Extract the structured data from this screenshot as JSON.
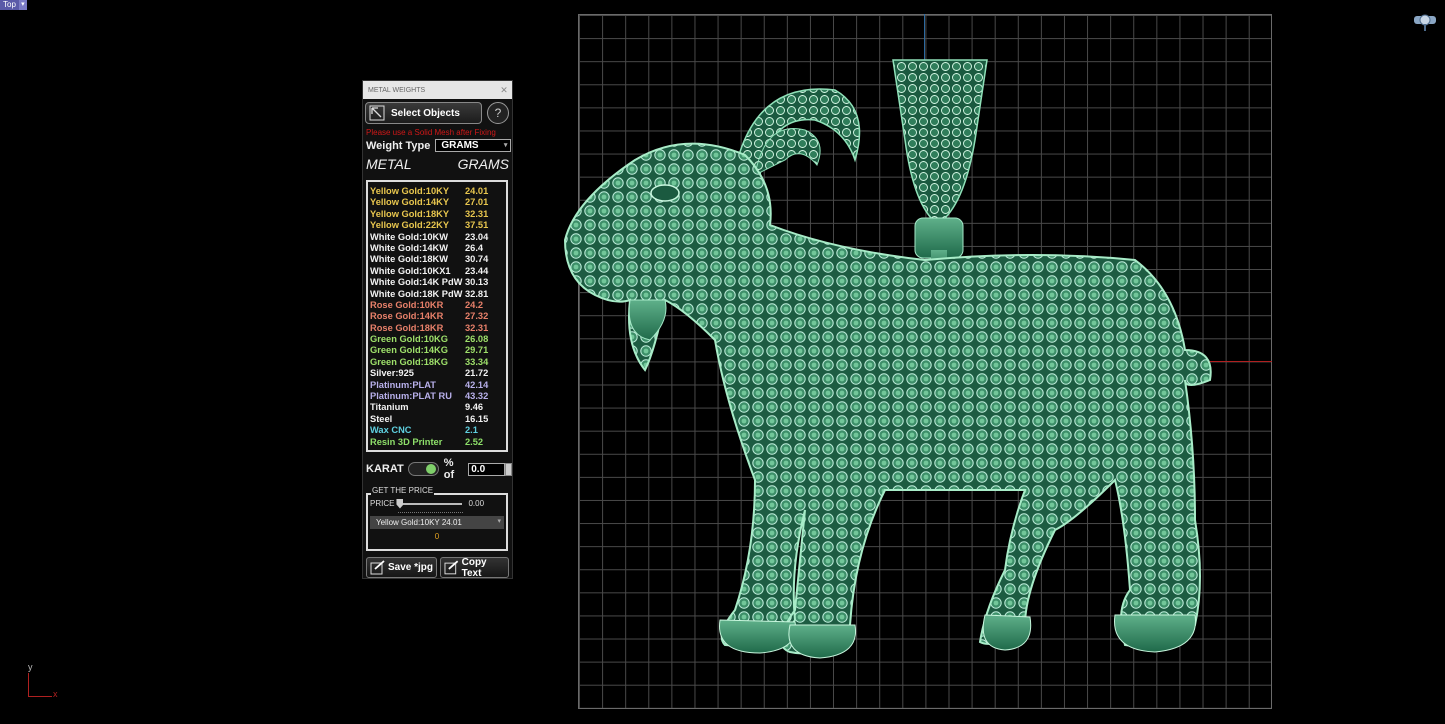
{
  "viewport": {
    "label": "Top",
    "axis_x": "x",
    "axis_y": "y"
  },
  "panel": {
    "title": "METAL WEIGHTS",
    "select_label": "Select Objects",
    "help_label": "?",
    "warning": "Please use a Solid Mesh after Fixing",
    "weight_type_label": "Weight Type",
    "weight_type_value": "GRAMS",
    "col_metal": "METAL",
    "col_grams": "GRAMS",
    "metals": [
      {
        "name": "Yellow Gold:10KY",
        "grams": "24.01",
        "color": "#e8c64e"
      },
      {
        "name": "Yellow Gold:14KY",
        "grams": "27.01",
        "color": "#e8c64e"
      },
      {
        "name": "Yellow Gold:18KY",
        "grams": "32.31",
        "color": "#e8c64e"
      },
      {
        "name": "Yellow Gold:22KY",
        "grams": "37.51",
        "color": "#e8c64e"
      },
      {
        "name": "White Gold:10KW",
        "grams": "23.04",
        "color": "#f2f2f2"
      },
      {
        "name": "White Gold:14KW",
        "grams": "26.4",
        "color": "#f2f2f2"
      },
      {
        "name": "White Gold:18KW",
        "grams": "30.74",
        "color": "#f2f2f2"
      },
      {
        "name": "White Gold:10KX1",
        "grams": "23.44",
        "color": "#f2f2f2"
      },
      {
        "name": "White Gold:14K PdW",
        "grams": "30.13",
        "color": "#f2f2f2"
      },
      {
        "name": "White Gold:18K PdW",
        "grams": "32.81",
        "color": "#f2f2f2"
      },
      {
        "name": "Rose Gold:10KR",
        "grams": "24.2",
        "color": "#e8806a"
      },
      {
        "name": "Rose Gold:14KR",
        "grams": "27.32",
        "color": "#e8806a"
      },
      {
        "name": "Rose Gold:18KR",
        "grams": "32.31",
        "color": "#e8806a"
      },
      {
        "name": "Green Gold:10KG",
        "grams": "26.08",
        "color": "#9ee06a"
      },
      {
        "name": "Green Gold:14KG",
        "grams": "29.71",
        "color": "#9ee06a"
      },
      {
        "name": "Green Gold:18KG",
        "grams": "33.34",
        "color": "#9ee06a"
      },
      {
        "name": "Silver:925",
        "grams": "21.72",
        "color": "#f2f2f2"
      },
      {
        "name": "Platinum:PLAT",
        "grams": "42.14",
        "color": "#b8b0ea"
      },
      {
        "name": "Platinum:PLAT RU",
        "grams": "43.32",
        "color": "#b8b0ea"
      },
      {
        "name": "Titanium",
        "grams": "9.46",
        "color": "#f2f2f2"
      },
      {
        "name": "Steel",
        "grams": "16.15",
        "color": "#f2f2f2"
      },
      {
        "name": "Wax  CNC",
        "grams": "2.1",
        "color": "#5fd0e0"
      },
      {
        "name": "Resin 3D Printer",
        "grams": "2.52",
        "color": "#8ee06a"
      }
    ],
    "karat_label": "KARAT",
    "pct_label": "% of",
    "pct_value": "0.0",
    "price_group": "GET THE PRICE",
    "price_label": "PRICE",
    "price_value": "0.00",
    "price_slider_fraction": 0,
    "combo_value": "Yellow Gold:10KY 24.01",
    "total": "0",
    "save_label": "Save *jpg",
    "copy_label": "Copy  Text"
  }
}
